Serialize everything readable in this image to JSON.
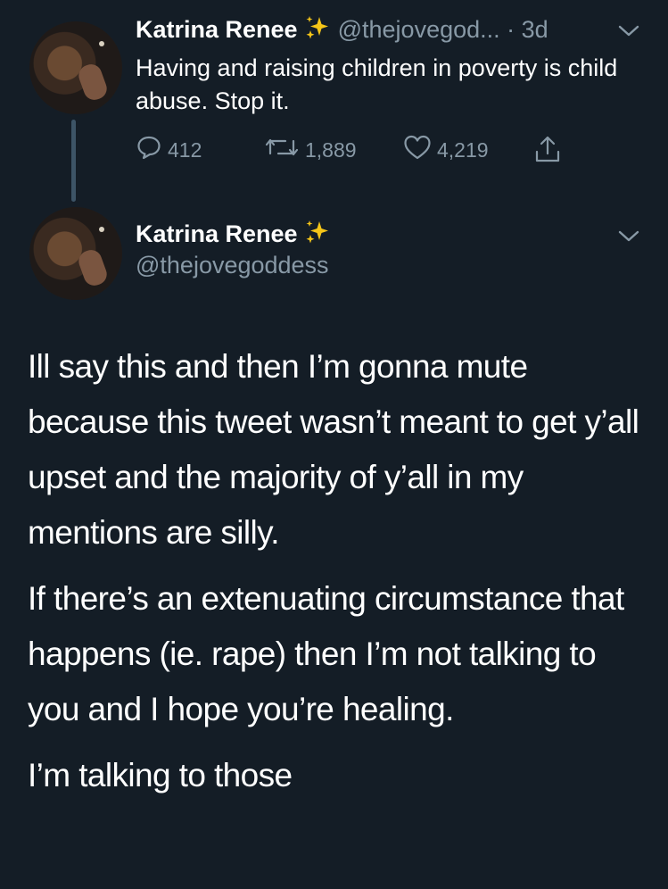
{
  "tweet1": {
    "name": "Katrina Renee",
    "handle": "@thejovegod...",
    "time": "· 3d",
    "text": "Having and raising children in poverty is child abuse. Stop it.",
    "replies": "412",
    "retweets": "1,889",
    "likes": "4,219"
  },
  "tweet2": {
    "name": "Katrina Renee",
    "handle": "@thejovegoddess",
    "paragraphs": [
      "Ill say this and then I’m gonna mute because this tweet wasn’t meant to get y’all upset and the majority of y’all in my mentions are silly.",
      "If there’s an extenuating circumstance that happens (ie. rape) then I’m not talking to you and I hope you’re healing.",
      "I’m talking to those"
    ]
  },
  "icons": [
    "sparkles-emoji",
    "chevron-down-icon",
    "reply-icon",
    "retweet-icon",
    "like-icon",
    "share-icon"
  ],
  "colors": {
    "background": "#141d26",
    "muted": "#8899a6",
    "thread_line": "#3d5466",
    "sparkle": "#f5c518"
  }
}
